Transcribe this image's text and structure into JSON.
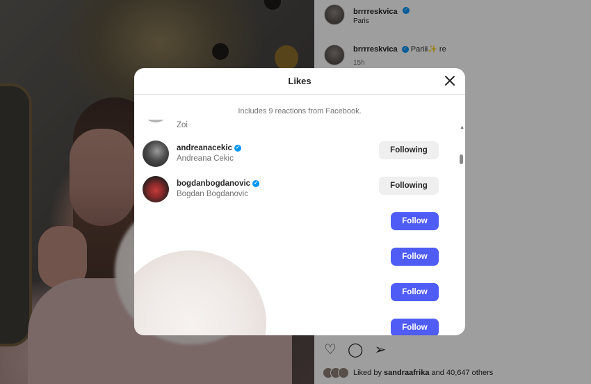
{
  "post": {
    "username": "brrrreskvica",
    "location": "Paris",
    "caption_user": "brrrreskvica",
    "caption_text": "Pariii✨ re",
    "caption_time": "15h",
    "liked_by_prefix": "Liked by",
    "liked_by_user": "sandraafrika",
    "liked_by_suffix": "and 40,647 others"
  },
  "likes_modal": {
    "title": "Likes",
    "reactions_note": "Includes 9 reactions from Facebook.",
    "rows": [
      {
        "handle": "",
        "fullname": "Zoi",
        "verified": false,
        "button": "",
        "state": "partial"
      },
      {
        "handle": "andreanacekic",
        "fullname": "Andreana Cekic",
        "verified": true,
        "button": "Following"
      },
      {
        "handle": "bogdanbogdanovic",
        "fullname": "Bogdan Bogdanovic",
        "verified": true,
        "button": "Following"
      },
      {
        "handle": "",
        "fullname": "",
        "verified": false,
        "button": "Follow"
      },
      {
        "handle": "",
        "fullname": "",
        "verified": false,
        "button": "Follow"
      },
      {
        "handle": "",
        "fullname": "",
        "verified": false,
        "button": "Follow"
      },
      {
        "handle": "",
        "fullname": "",
        "verified": false,
        "button": "Follow"
      }
    ]
  },
  "icons": {
    "close": "close-icon",
    "verified": "verified-badge-icon",
    "like": "heart-icon",
    "comment": "comment-icon",
    "share": "send-icon"
  },
  "colors": {
    "follow_button": "#4f5cf5",
    "following_button": "#efefef",
    "verified": "#0095f6"
  }
}
